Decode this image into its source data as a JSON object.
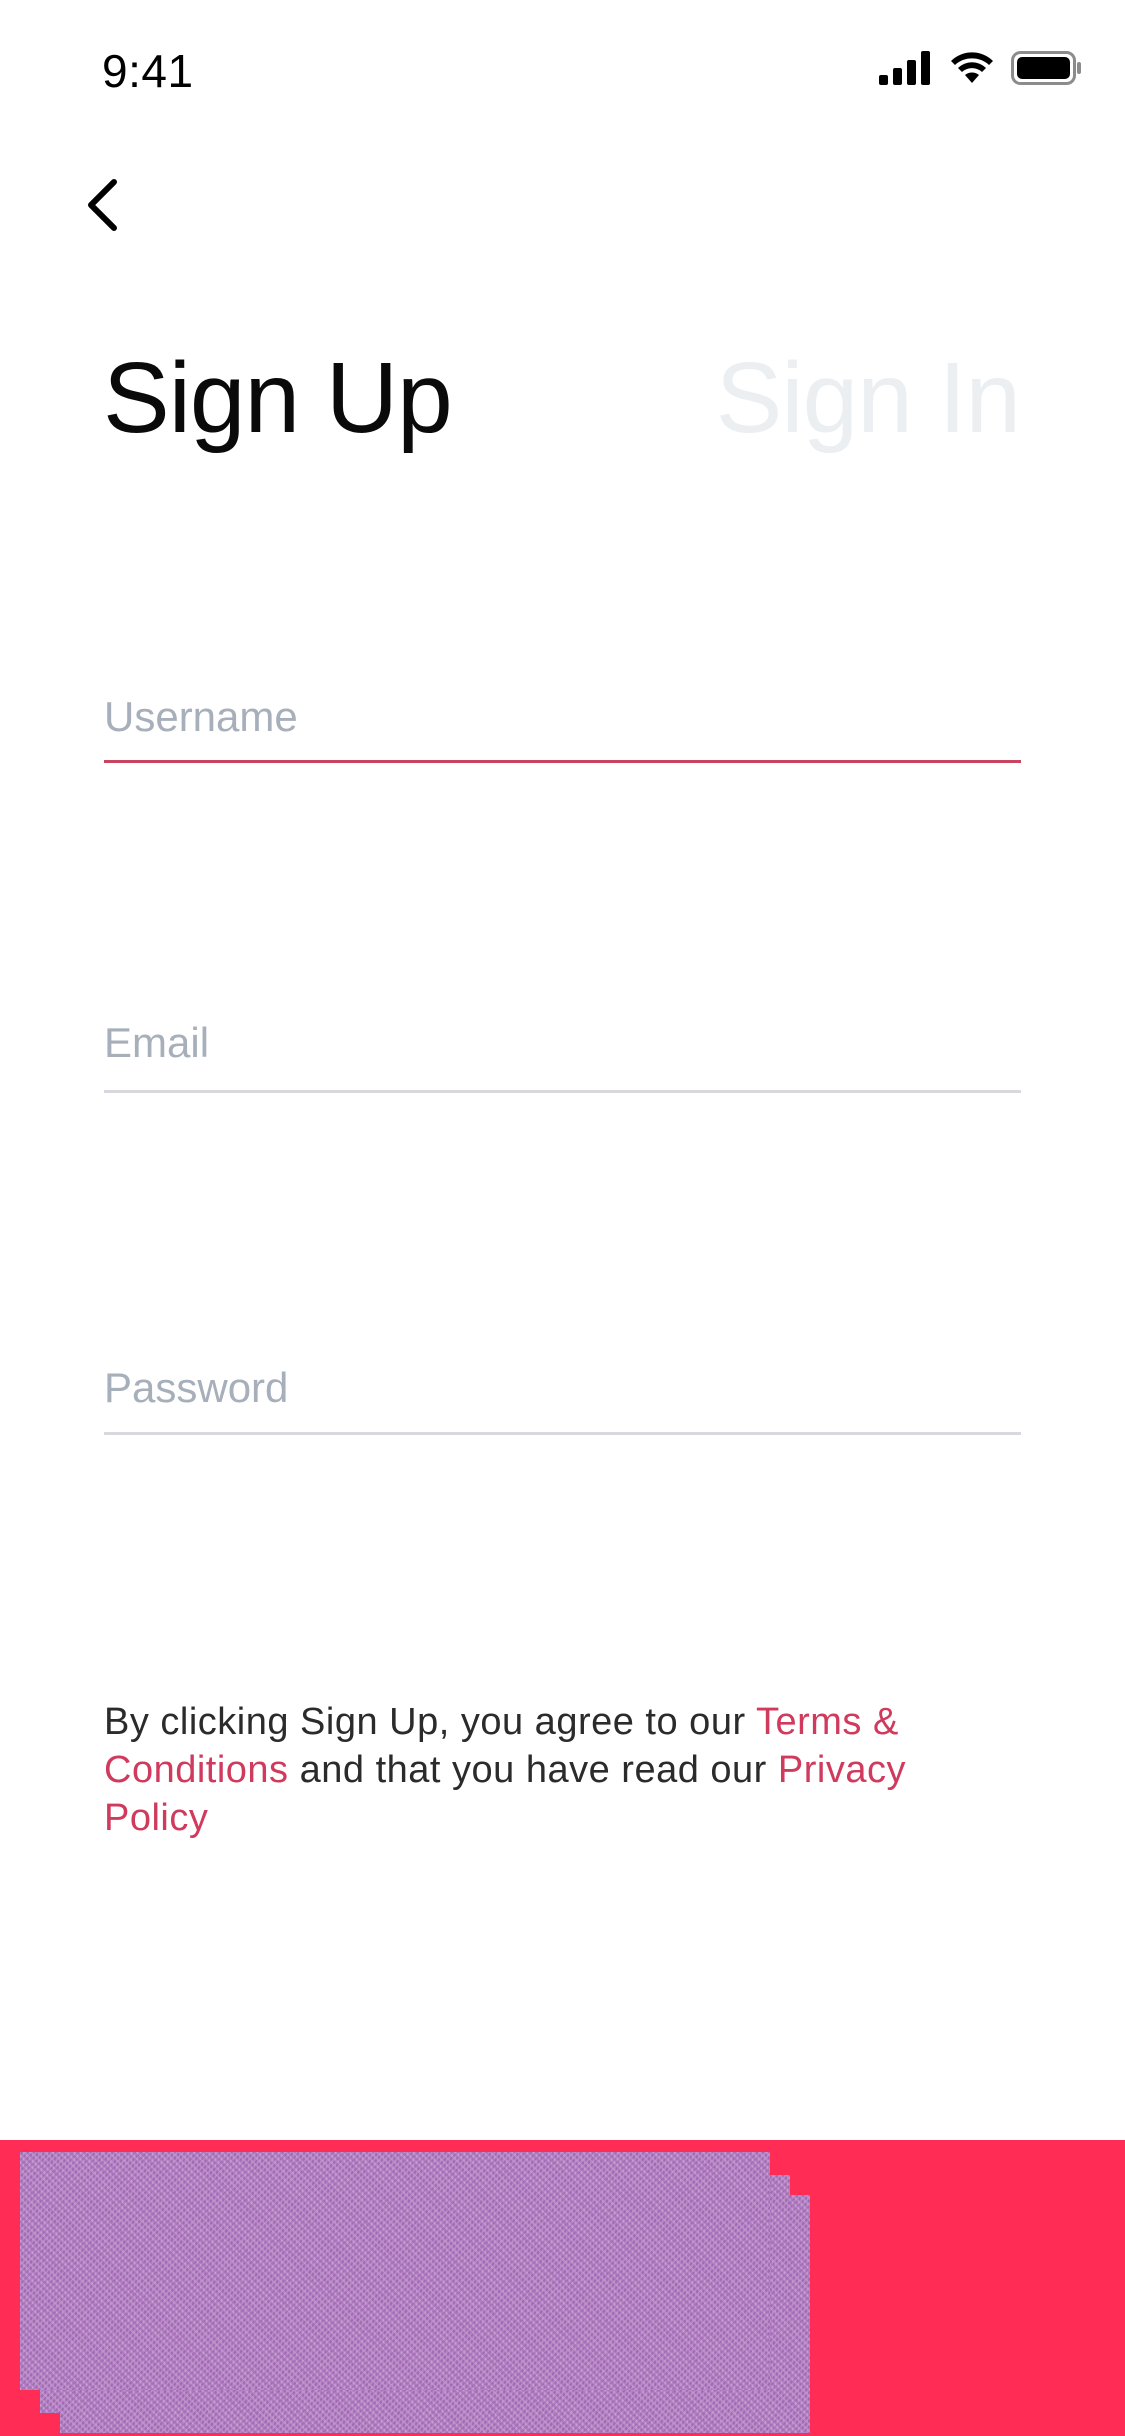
{
  "status_bar": {
    "time": "9:41",
    "icons": [
      "cellular-signal-icon",
      "wifi-icon",
      "battery-icon"
    ]
  },
  "nav": {
    "back_icon": "chevron-left-icon"
  },
  "tabs": {
    "sign_up": "Sign Up",
    "sign_in": "Sign In",
    "active": "sign_up"
  },
  "form": {
    "username": {
      "value": "",
      "placeholder": "Username"
    },
    "email": {
      "value": "",
      "placeholder": "Email"
    },
    "password": {
      "value": "",
      "placeholder": "Password"
    }
  },
  "terms": {
    "prefix": "By clicking Sign Up, you agree to our ",
    "terms_link": "Terms & Conditions",
    "middle": " and that you have read our ",
    "privacy_link": "Privacy Policy"
  },
  "colors": {
    "accent": "#d03a5c",
    "bottom_bar": "#ff2d55",
    "inactive_tab": "#eceff1",
    "placeholder": "#a7afba",
    "divider": "#d7d9de"
  }
}
